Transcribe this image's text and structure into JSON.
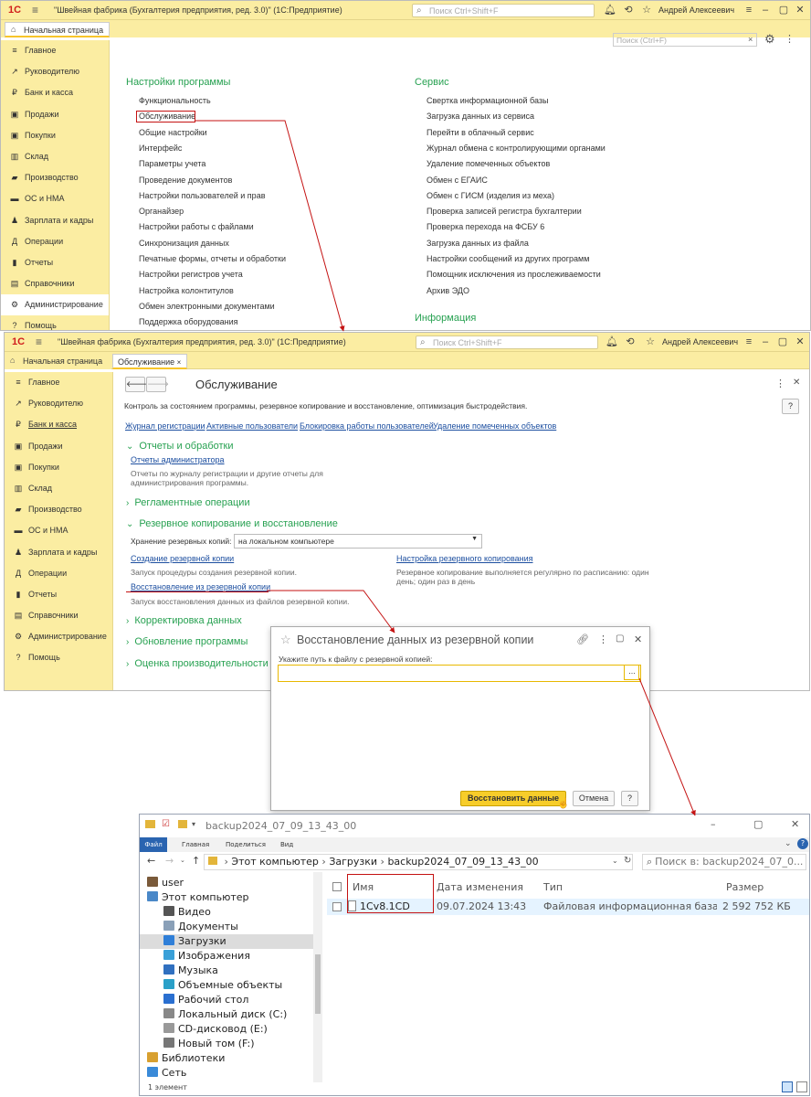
{
  "app": {
    "logo": "1С",
    "title": "\"Швейная фабрика (Бухгалтерия предприятия, ред. 3.0)\"  (1С:Предприятие)",
    "search_placeholder": "Поиск Ctrl+Shift+F",
    "user": "Андрей Алексеевич",
    "home_tab": "Начальная страница"
  },
  "sidebar": {
    "items": [
      {
        "label": "Главное",
        "icon": "≡"
      },
      {
        "label": "Руководителю",
        "icon": "↗"
      },
      {
        "label": "Банк и касса",
        "icon": "₽"
      },
      {
        "label": "Продажи",
        "icon": "▣"
      },
      {
        "label": "Покупки",
        "icon": "▣"
      },
      {
        "label": "Склад",
        "icon": "▥"
      },
      {
        "label": "Производство",
        "icon": "▰"
      },
      {
        "label": "ОС и НМА",
        "icon": "▬"
      },
      {
        "label": "Зарплата и кадры",
        "icon": "♟"
      },
      {
        "label": "Операции",
        "icon": "Д"
      },
      {
        "label": "Отчеты",
        "icon": "▮"
      },
      {
        "label": "Справочники",
        "icon": "▤"
      },
      {
        "label": "Администрирование",
        "icon": "⚙"
      },
      {
        "label": "Помощь",
        "icon": "?"
      }
    ]
  },
  "settings_page": {
    "search_placeholder": "Поиск (Ctrl+F)",
    "col1_title": "Настройки программы",
    "col1": [
      "Функциональность",
      "Обслуживание",
      "Общие настройки",
      "Интерфейс",
      "Параметры учета",
      "Проведение документов",
      "Настройки пользователей и прав",
      "Органайзер",
      "Настройки работы с файлами",
      "Синхронизация данных",
      "Печатные формы, отчеты и обработки",
      "Настройки регистров учета",
      "Настройка колонтитулов",
      "Обмен электронными документами",
      "Поддержка оборудования"
    ],
    "col2_title": "Сервис",
    "col2": [
      "Свертка информационной базы",
      "Загрузка данных из сервиса",
      "Перейти в облачный сервис",
      "Журнал обмена с контролирующими органами",
      "Удаление помеченных объектов",
      "Обмен с ЕГАИС",
      "Обмен с ГИСМ (изделия из меха)",
      "Проверка записей регистра бухгалтерии",
      "Проверка перехода на ФСБУ 6",
      "Загрузка данных из файла",
      "Настройки сообщений из других программ",
      "Помощник исключения из прослеживаемости",
      "Архив ЭДО"
    ],
    "col2_title2": "Информация"
  },
  "maint": {
    "tab": "Обслуживание",
    "title": "Обслуживание",
    "desc": "Контроль за состоянием программы, резервное копирование и восстановление, оптимизация быстродействия.",
    "links": [
      "Журнал регистрации",
      "Активные пользователи",
      "Блокировка работы пользователей",
      "Удаление помеченных объектов"
    ],
    "g1": "Отчеты и обработки",
    "g1_link": "Отчеты администратора",
    "g1_desc1": "Отчеты по журналу регистрации и другие отчеты для",
    "g1_desc2": "администрирования программы.",
    "g2": "Регламентные операции",
    "g3": "Резервное копирование и восстановление",
    "storage_label": "Хранение резервных копий:",
    "storage_value": "на локальном компьютере",
    "create_link": "Создание резервной копии",
    "create_desc": "Запуск процедуры создания резервной копии.",
    "setup_link": "Настройка резервного копирования",
    "setup_desc1": "Резервное копирование выполняется регулярно по расписанию: один",
    "setup_desc2": "день; один раз в день",
    "restore_link": "Восстановление из резервной копии",
    "restore_desc": "Запуск восстановления данных из файлов резервной копии.",
    "g4": "Корректировка данных",
    "g5": "Обновление программы",
    "g6": "Оценка производительности"
  },
  "dialog": {
    "title": "Восстановление данных из резервной копии",
    "label": "Укажите путь к файлу с резервной копией:",
    "input_value": "",
    "browse": "...",
    "restore_btn": "Восстановить данные",
    "cancel_btn": "Отмена",
    "help_btn": "?"
  },
  "explorer": {
    "title": "backup2024_07_09_13_43_00",
    "ribbon": [
      "Файл",
      "Главная",
      "Поделиться",
      "Вид"
    ],
    "breadcrumb": [
      "Этот компьютер",
      "Загрузки",
      "backup2024_07_09_13_43_00"
    ],
    "search_placeholder": "Поиск в: backup2024_07_0...",
    "tree": [
      {
        "label": "user",
        "color": "#7a5a3a"
      },
      {
        "label": "Этот компьютер",
        "color": "#4a88c8"
      },
      {
        "label": "Видео",
        "color": "#555555"
      },
      {
        "label": "Документы",
        "color": "#8aa0b8"
      },
      {
        "label": "Загрузки",
        "color": "#2f7fd8"
      },
      {
        "label": "Изображения",
        "color": "#3aa0d8"
      },
      {
        "label": "Музыка",
        "color": "#3070c0"
      },
      {
        "label": "Объемные объекты",
        "color": "#2aa0c8"
      },
      {
        "label": "Рабочий стол",
        "color": "#2a6fd0"
      },
      {
        "label": "Локальный диск (C:)",
        "color": "#888888"
      },
      {
        "label": "CD-дисковод (E:)",
        "color": "#999999"
      },
      {
        "label": "Новый том (F:)",
        "color": "#777777"
      },
      {
        "label": "Библиотеки",
        "color": "#d8a030"
      },
      {
        "label": "Сеть",
        "color": "#3a8ad8"
      }
    ],
    "columns": [
      "Имя",
      "Дата изменения",
      "Тип",
      "Размер"
    ],
    "file": {
      "name": "1Cv8.1CD",
      "date": "09.07.2024 13:43",
      "type": "Файловая информационная база...",
      "size": "2 592 752 КБ"
    },
    "status": "1 элемент"
  }
}
